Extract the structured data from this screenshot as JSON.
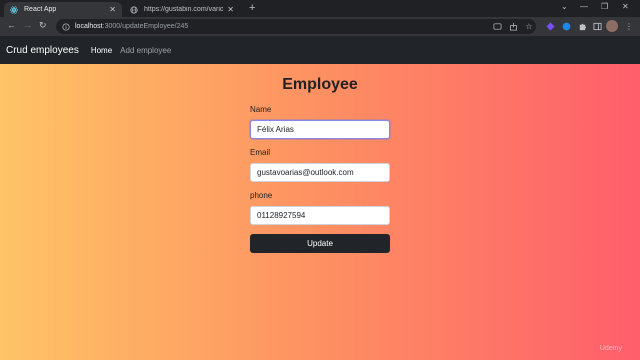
{
  "browser": {
    "tabs": [
      {
        "title": "React App"
      },
      {
        "title": "https://gustabin.com/various/api..."
      }
    ],
    "new_tab": "+",
    "window_controls": {
      "chevron": "⌄",
      "minimize": "—",
      "restore": "❐",
      "close": "✕"
    },
    "address": {
      "host": "localhost",
      "path": ":3000/updateEmployee/245"
    }
  },
  "navbar": {
    "brand": "Crud employees",
    "links": [
      "Home",
      "Add employee"
    ]
  },
  "form": {
    "title": "Employee",
    "fields": [
      {
        "label": "Name",
        "value": "Félix Arias"
      },
      {
        "label": "Email",
        "value": "gustavoarias@outlook.com"
      },
      {
        "label": "phone",
        "value": "01128927594"
      }
    ],
    "submit_label": "Update"
  },
  "watermark": "Udemy",
  "colors": {
    "gradient_start": "#fec466",
    "gradient_mid": "#fd9062",
    "gradient_end": "#ff5e6c",
    "navbar_bg": "#212529",
    "button_bg": "#212529"
  }
}
